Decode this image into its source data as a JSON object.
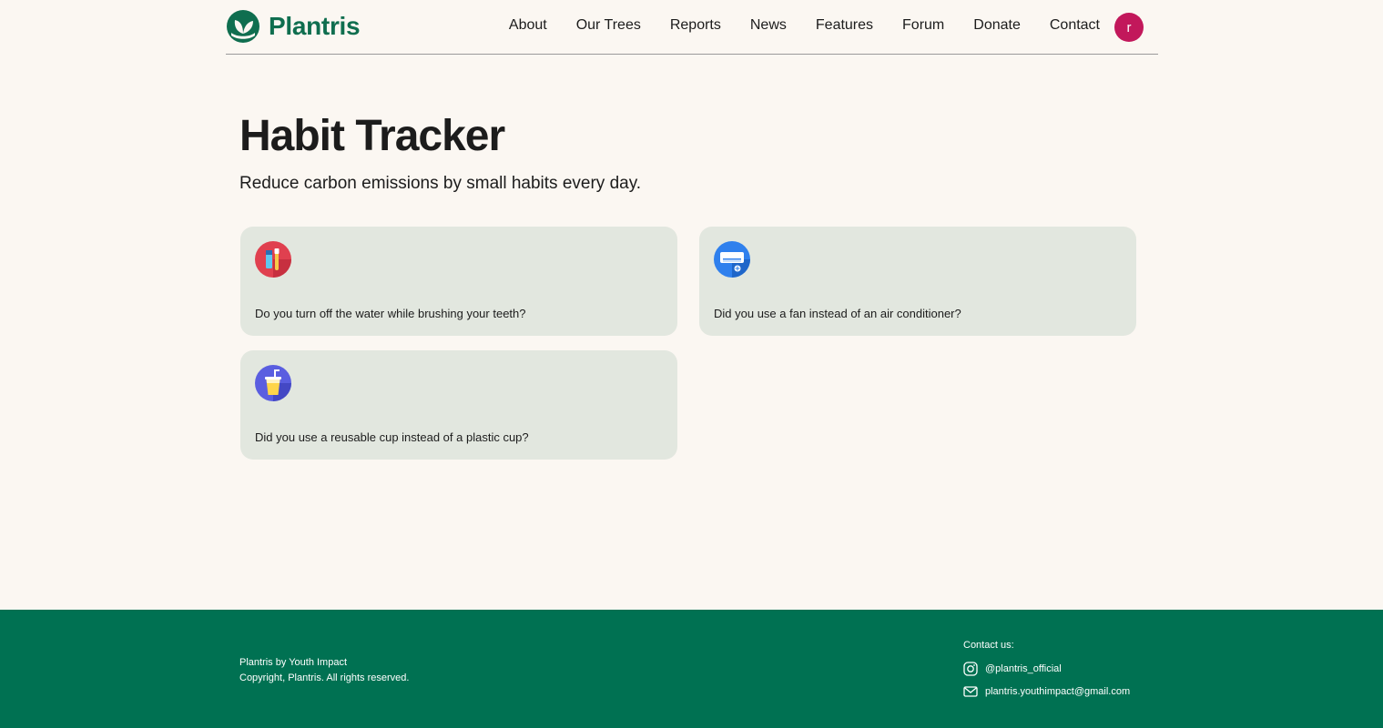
{
  "header": {
    "logo_text": "Plantris",
    "nav": [
      "About",
      "Our Trees",
      "Reports",
      "News",
      "Features",
      "Forum",
      "Donate",
      "Contact"
    ],
    "avatar_letter": "r"
  },
  "main": {
    "title": "Habit Tracker",
    "subtitle": "Reduce carbon emissions by small habits every day.",
    "habits": [
      {
        "icon": "toothbrush-icon",
        "text": "Do you turn off the water while brushing your teeth?"
      },
      {
        "icon": "air-conditioner-icon",
        "text": "Did you use a fan instead of an air conditioner?"
      },
      {
        "icon": "reusable-cup-icon",
        "text": "Did you use a reusable cup instead of a plastic cup?"
      }
    ]
  },
  "footer": {
    "brand_line1": "Plantris by Youth Impact",
    "brand_line2": "Copyright, Plantris. All rights reserved.",
    "contact_label": "Contact us:",
    "instagram": "@plantris_official",
    "email": "plantris.youthimpact@gmail.com"
  },
  "colors": {
    "brand_green": "#0f6e4f",
    "footer_green": "#007152",
    "avatar": "#c2185b",
    "card_bg": "#e2e7df",
    "page_bg": "#fbf7f2"
  }
}
